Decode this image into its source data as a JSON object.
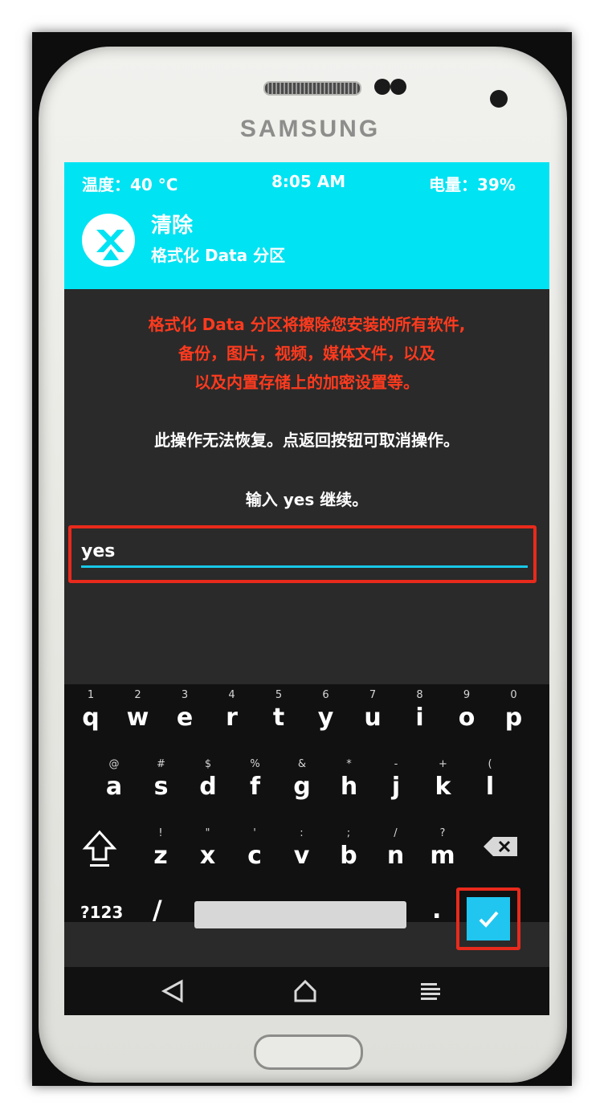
{
  "device": {
    "brand": "SAMSUNG"
  },
  "status_bar": {
    "temperature": "温度：40 °C",
    "time": "8:05 AM",
    "battery": "电量：39%"
  },
  "header": {
    "title": "清除",
    "subtitle": "格式化 Data 分区",
    "icon": "twrp-logo-icon"
  },
  "warning_lines": [
    "格式化 Data 分区将擦除您安装的所有软件,",
    "备份，图片，视频，媒体文件，以及",
    "以及内置存储上的加密设置等。"
  ],
  "info_text": "此操作无法恢复。点返回按钮可取消操作。",
  "prompt_text": "输入 yes 继续。",
  "input": {
    "value": "yes"
  },
  "keyboard": {
    "row1": [
      {
        "hint": "1",
        "label": "q"
      },
      {
        "hint": "2",
        "label": "w"
      },
      {
        "hint": "3",
        "label": "e"
      },
      {
        "hint": "4",
        "label": "r"
      },
      {
        "hint": "5",
        "label": "t"
      },
      {
        "hint": "6",
        "label": "y"
      },
      {
        "hint": "7",
        "label": "u"
      },
      {
        "hint": "8",
        "label": "i"
      },
      {
        "hint": "9",
        "label": "o"
      },
      {
        "hint": "0",
        "label": "p"
      }
    ],
    "row2": [
      {
        "hint": "@",
        "label": "a"
      },
      {
        "hint": "#",
        "label": "s"
      },
      {
        "hint": "$",
        "label": "d"
      },
      {
        "hint": "%",
        "label": "f"
      },
      {
        "hint": "&",
        "label": "g"
      },
      {
        "hint": "*",
        "label": "h"
      },
      {
        "hint": "-",
        "label": "j"
      },
      {
        "hint": "+",
        "label": "k"
      },
      {
        "hint": "(",
        "label": "l"
      }
    ],
    "row3": [
      {
        "hint": "!",
        "label": "z"
      },
      {
        "hint": "\"",
        "label": "x"
      },
      {
        "hint": "'",
        "label": "c"
      },
      {
        "hint": ":",
        "label": "v"
      },
      {
        "hint": ";",
        "label": "b"
      },
      {
        "hint": "/",
        "label": "n"
      },
      {
        "hint": "?",
        "label": "m"
      }
    ],
    "symbols_label": "?123",
    "slash_label": "/",
    "dot_label": ".",
    "shift_icon": "shift-icon",
    "delete_icon": "backspace-icon",
    "done_icon": "checkmark-icon"
  },
  "navigation": {
    "back_icon": "back-triangle-icon",
    "home_icon": "home-icon",
    "menu_icon": "menu-icon"
  },
  "colors": {
    "accent": "#00e3f3",
    "warning": "#ff3a1e",
    "highlight": "#e82a1c",
    "background": "#2a2a2a"
  }
}
